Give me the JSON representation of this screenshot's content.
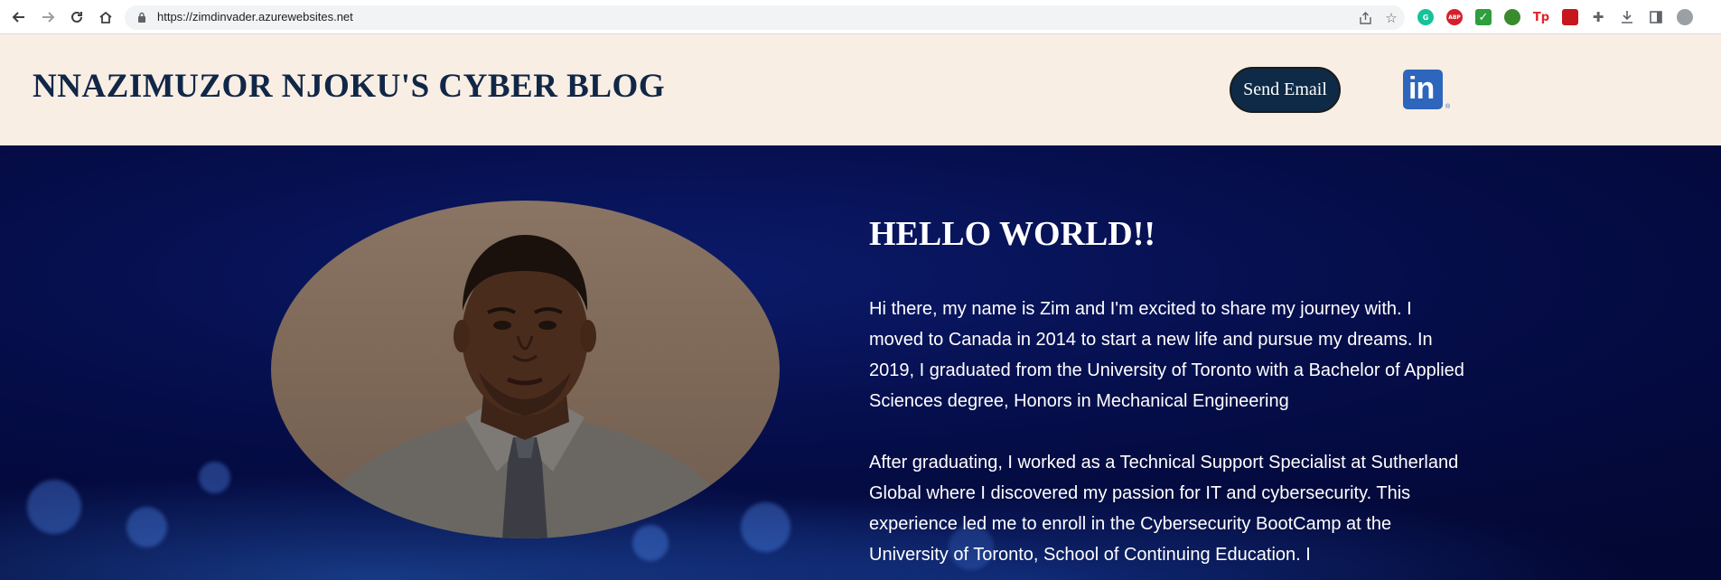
{
  "browser": {
    "url": "https://zimdinvader.azurewebsites.net",
    "extensions": [
      "grammarly-icon",
      "adblock-icon",
      "checkbox-extension-icon",
      "globe-extension-icon",
      "tp-extension-icon",
      "pdf-extension-icon",
      "puzzle-icon",
      "download-icon",
      "side-panel-icon",
      "profile-avatar"
    ],
    "adblock_label": "ABP",
    "tp_label": "Tp"
  },
  "header": {
    "title": "NNAZIMUZOR NJOKU'S CYBER BLOG",
    "email_button": "Send Email",
    "linkedin_label": "in",
    "linkedin_reg": "®"
  },
  "colors": {
    "header_bg": "#f9eee4",
    "title_color": "#102747",
    "button_bg": "#0e2a47",
    "hero_bg": "#050d48",
    "linkedin_blue": "#2d66bc"
  },
  "hero": {
    "greeting": "HELLO WORLD!!",
    "paragraph_1": "Hi there, my name is Zim and I'm excited to share my journey with. I moved to Canada in 2014 to start a new life and pursue my dreams. In 2019, I graduated from the University of Toronto with a Bachelor of Applied Sciences degree, Honors in Mechanical Engineering",
    "paragraph_2": "After graduating, I worked as a Technical Support Specialist at Sutherland Global where I discovered my passion for IT and cybersecurity. This experience led me to enroll in the Cybersecurity BootCamp at the University of Toronto, School of Continuing Education. I"
  }
}
